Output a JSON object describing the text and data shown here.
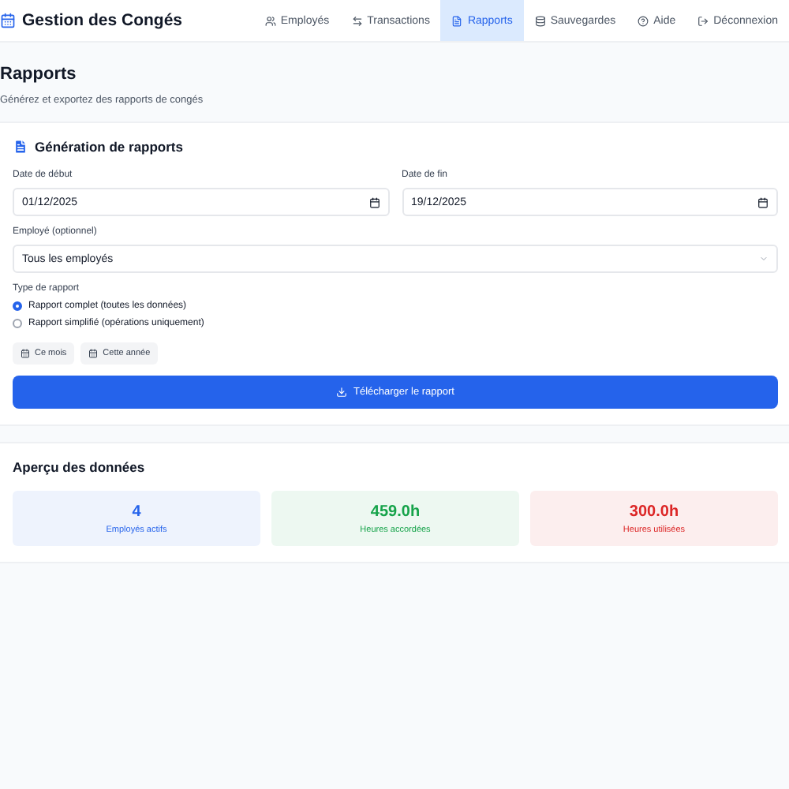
{
  "app": {
    "title": "Gestion des Congés"
  },
  "nav": [
    {
      "label": "Employés",
      "selected": false
    },
    {
      "label": "Transactions",
      "selected": false
    },
    {
      "label": "Rapports",
      "selected": true
    },
    {
      "label": "Sauvegardes",
      "selected": false
    },
    {
      "label": "Aide",
      "selected": false
    },
    {
      "label": "Déconnexion",
      "selected": false
    }
  ],
  "page": {
    "title": "Rapports",
    "subtitle": "Générez et exportez des rapports de congés"
  },
  "generator": {
    "title": "Génération de rapports",
    "start_date": {
      "label": "Date de début",
      "value": "01/12/2025"
    },
    "end_date": {
      "label": "Date de fin",
      "value": "19/12/2025"
    },
    "employee": {
      "label": "Employé (optionnel)",
      "value": "Tous les employés"
    },
    "report_type": {
      "label": "Type de rapport",
      "options": [
        {
          "label": "Rapport complet (toutes les données)",
          "selected": true
        },
        {
          "label": "Rapport simplifié (opérations uniquement)",
          "selected": false
        }
      ]
    },
    "quick_ranges": [
      "Ce mois",
      "Cette année"
    ],
    "download_button": "Télécharger le rapport"
  },
  "overview": {
    "title": "Aperçu des données",
    "stats": [
      {
        "value": "4",
        "label": "Employés actifs",
        "color": "#2563eb"
      },
      {
        "value": "459.0h",
        "label": "Heures accordées",
        "color": "#16a34a"
      },
      {
        "value": "300.0h",
        "label": "Heures utilisées",
        "color": "#dc2626"
      }
    ]
  }
}
